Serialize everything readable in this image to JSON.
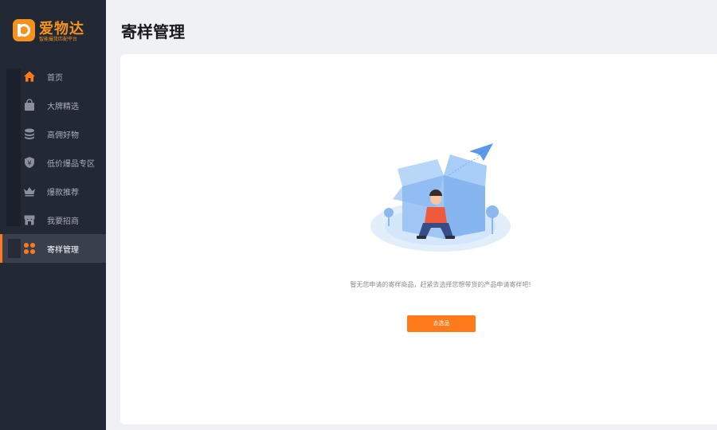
{
  "logo": {
    "name": "爱物达",
    "slogan": "智能撮货匹配平台"
  },
  "sidebar": {
    "items": [
      {
        "label": "首页",
        "icon": "home-icon",
        "active": false
      },
      {
        "label": "大牌精选",
        "icon": "shopping-bag-icon",
        "active": false
      },
      {
        "label": "高佣好物",
        "icon": "coin-stack-icon",
        "active": false
      },
      {
        "label": "低价爆品专区",
        "icon": "yuan-shield-icon",
        "active": false
      },
      {
        "label": "爆款推荐",
        "icon": "crown-icon",
        "active": false
      },
      {
        "label": "我要招商",
        "icon": "storefront-icon",
        "active": false
      },
      {
        "label": "寄样管理",
        "icon": "grid-dots-icon",
        "active": true
      }
    ]
  },
  "main": {
    "title": "寄样管理",
    "empty_message": "暂无您申请的寄样商品，赶紧去选择您想带货的产品申请寄样吧!",
    "action_label": "去选品"
  },
  "colors": {
    "accent": "#ff7a1a",
    "sidebar_bg": "#232835",
    "page_bg": "#f0f1f5"
  }
}
